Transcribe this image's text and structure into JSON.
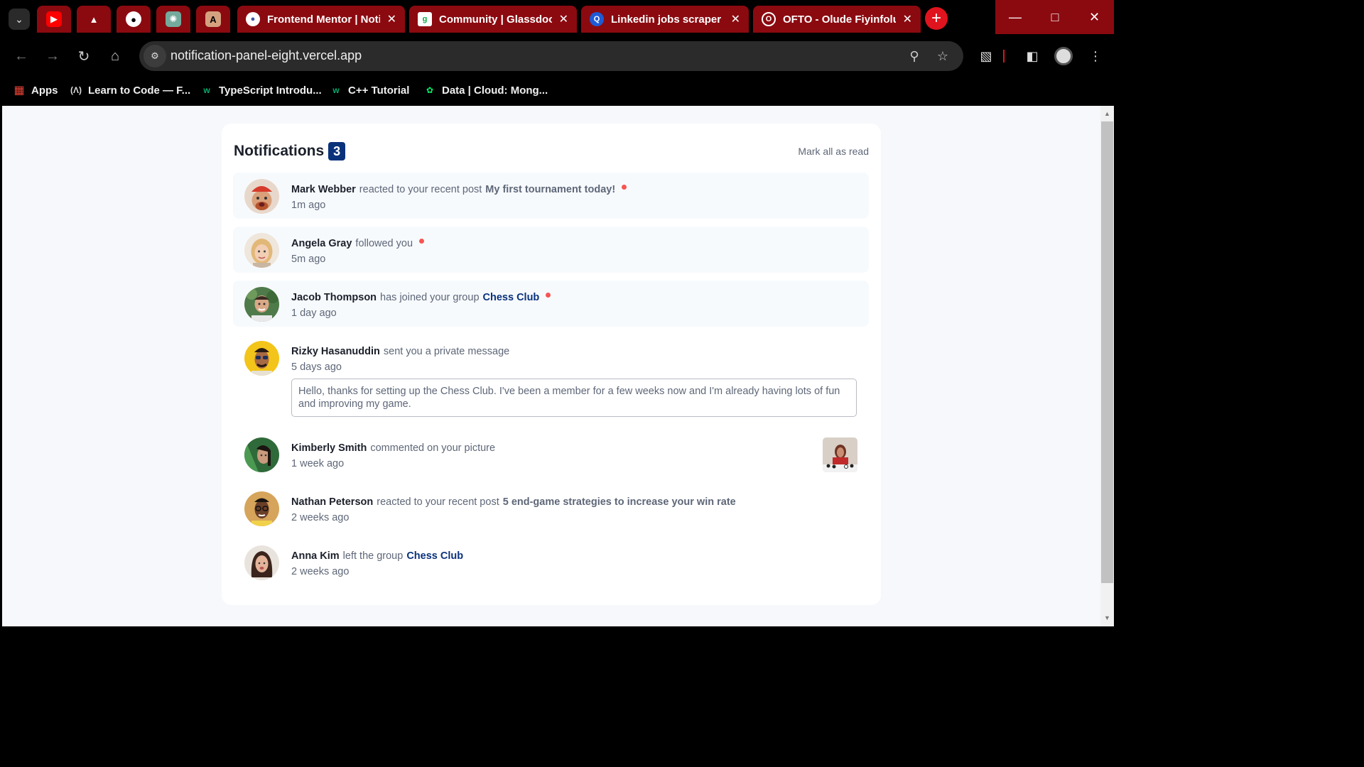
{
  "browser": {
    "tabs": [
      {
        "title": "Frontend Mentor | Noti",
        "icon": "frontend-mentor-icon"
      },
      {
        "title": "Community | Glassdoor",
        "icon": "glassdoor-icon"
      },
      {
        "title": "Linkedin jobs scraper A",
        "icon": "linkedin-scraper-icon"
      },
      {
        "title": "OFTO - Olude Fiyinfolu",
        "icon": "ofto-icon"
      }
    ],
    "url": "notification-panel-eight.vercel.app",
    "bookmarks": [
      {
        "label": "Apps",
        "icon": "apps-grid-icon"
      },
      {
        "label": "Learn to Code — F...",
        "icon": "freecodecamp-icon"
      },
      {
        "label": "TypeScript Introdu...",
        "icon": "w3schools-icon"
      },
      {
        "label": "C++ Tutorial",
        "icon": "w3schools-icon"
      },
      {
        "label": "Data | Cloud: Mong...",
        "icon": "mongodb-leaf-icon"
      }
    ]
  },
  "panel": {
    "title": "Notifications",
    "unread_count": "3",
    "mark_all_label": "Mark all as read",
    "notifications": [
      {
        "name": "Mark Webber",
        "action": "reacted to your recent post",
        "post": "My first tournament today!",
        "time": "1m ago",
        "unread": true
      },
      {
        "name": "Angela Gray",
        "action": "followed you",
        "time": "5m ago",
        "unread": true
      },
      {
        "name": "Jacob Thompson",
        "action": "has joined your group",
        "group": "Chess Club",
        "time": "1 day ago",
        "unread": true
      },
      {
        "name": "Rizky Hasanuddin",
        "action": "sent you a private message",
        "time": "5 days ago",
        "unread": false,
        "message": "Hello, thanks for setting up the Chess Club. I've been a member for a few weeks now and I'm already having lots of fun and improving my game."
      },
      {
        "name": "Kimberly Smith",
        "action": "commented on your picture",
        "time": "1 week ago",
        "unread": false
      },
      {
        "name": "Nathan Peterson",
        "action": "reacted to your recent post",
        "post": "5 end-game strategies to increase your win rate",
        "time": "2 weeks ago",
        "unread": false
      },
      {
        "name": "Anna Kim",
        "action": "left the group",
        "group": "Chess Club",
        "time": "2 weeks ago",
        "unread": false
      }
    ]
  },
  "colors": {
    "accent_blue": "#0a327b",
    "unread_dot": "#f65552",
    "unread_bg": "#f7fafd",
    "tab_red": "#8b0a10"
  }
}
